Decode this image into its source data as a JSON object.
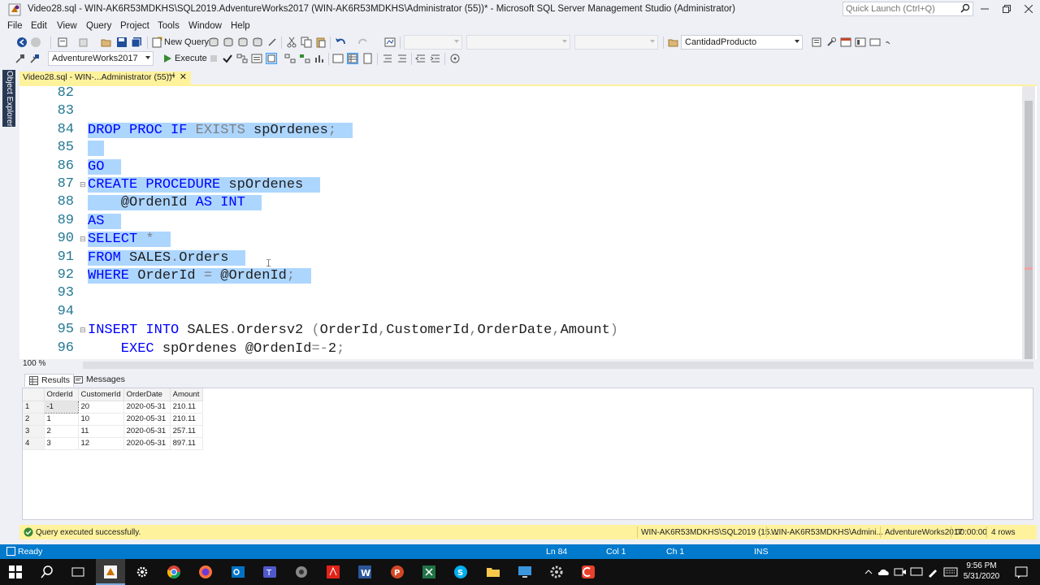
{
  "window": {
    "title": "Video28.sql - WIN-AK6R53MDKHS\\SQL2019.AdventureWorks2017 (WIN-AK6R53MDKHS\\Administrator (55))* - Microsoft SQL Server Management Studio (Administrator)",
    "quick_launch_placeholder": "Quick Launch (Ctrl+Q)"
  },
  "menu": [
    "File",
    "Edit",
    "View",
    "Query",
    "Project",
    "Tools",
    "Window",
    "Help"
  ],
  "toolbar": {
    "new_query_label": "New Query",
    "database": "AdventureWorks2017",
    "execute_label": "Execute",
    "object_combo": "CantidadProducto"
  },
  "side_panel": {
    "label": "Object Explorer"
  },
  "document_tab": {
    "label": "Video28.sql - WIN-...Administrator (55))*",
    "pin": "⊣",
    "close": "✕"
  },
  "editor": {
    "line_numbers": [
      "82",
      "83",
      "84",
      "85",
      "86",
      "87",
      "88",
      "89",
      "90",
      "91",
      "92",
      "93",
      "94",
      "95",
      "96"
    ],
    "lines": [
      [],
      [],
      [
        {
          "t": "DROP PROC IF ",
          "c": "kw"
        },
        {
          "t": "EXISTS",
          "c": "gr"
        },
        {
          "t": " spOrdenes",
          "c": "pl"
        },
        {
          "t": ";",
          "c": "gr"
        }
      ],
      [],
      [
        {
          "t": "GO",
          "c": "kw"
        }
      ],
      [
        {
          "t": "CREATE PROCEDURE",
          "c": "kw"
        },
        {
          "t": " spOrdenes",
          "c": "pl"
        }
      ],
      [
        {
          "t": "    @OrdenId",
          "c": "pl"
        },
        {
          "t": " AS ",
          "c": "kw"
        },
        {
          "t": "INT",
          "c": "kw"
        }
      ],
      [
        {
          "t": "AS",
          "c": "kw"
        }
      ],
      [
        {
          "t": "SELECT",
          "c": "kw"
        },
        {
          "t": " *",
          "c": "gr"
        }
      ],
      [
        {
          "t": "FROM",
          "c": "kw"
        },
        {
          "t": " SALES",
          "c": "pl"
        },
        {
          "t": ".",
          "c": "gr"
        },
        {
          "t": "Orders",
          "c": "pl"
        }
      ],
      [
        {
          "t": "WHERE",
          "c": "kw"
        },
        {
          "t": " OrderId ",
          "c": "pl"
        },
        {
          "t": "=",
          "c": "gr"
        },
        {
          "t": " @OrdenId",
          "c": "pl"
        },
        {
          "t": ";",
          "c": "gr"
        }
      ],
      [],
      [],
      [
        {
          "t": "INSERT INTO",
          "c": "kw"
        },
        {
          "t": " SALES",
          "c": "pl"
        },
        {
          "t": ".",
          "c": "gr"
        },
        {
          "t": "Ordersv2 ",
          "c": "pl"
        },
        {
          "t": "(",
          "c": "gr"
        },
        {
          "t": "OrderId",
          "c": "pl"
        },
        {
          "t": ",",
          "c": "gr"
        },
        {
          "t": "CustomerId",
          "c": "pl"
        },
        {
          "t": ",",
          "c": "gr"
        },
        {
          "t": "OrderDate",
          "c": "pl"
        },
        {
          "t": ",",
          "c": "gr"
        },
        {
          "t": "Amount",
          "c": "pl"
        },
        {
          "t": ")",
          "c": "gr"
        }
      ],
      [
        {
          "t": "    EXEC",
          "c": "kw"
        },
        {
          "t": " spOrdenes @OrdenId",
          "c": "pl"
        },
        {
          "t": "=-",
          "c": "gr"
        },
        {
          "t": "2",
          "c": "pl"
        },
        {
          "t": ";",
          "c": "gr"
        }
      ]
    ],
    "selected_lines": [
      2,
      3,
      4,
      5,
      6,
      7,
      8,
      9,
      10
    ],
    "collapse_markers": [
      5,
      8,
      13
    ],
    "zoom": "100 %"
  },
  "results": {
    "tabs": [
      "Results",
      "Messages"
    ],
    "columns": [
      "OrderId",
      "CustomerId",
      "OrderDate",
      "Amount"
    ],
    "rows": [
      {
        "n": "1",
        "cells": [
          "-1",
          "20",
          "2020-05-31",
          "210.11"
        ]
      },
      {
        "n": "2",
        "cells": [
          "1",
          "10",
          "2020-05-31",
          "210.11"
        ]
      },
      {
        "n": "3",
        "cells": [
          "2",
          "11",
          "2020-05-31",
          "257.11"
        ]
      },
      {
        "n": "4",
        "cells": [
          "3",
          "12",
          "2020-05-31",
          "897.11"
        ]
      }
    ]
  },
  "query_status": {
    "message": "Query executed successfully.",
    "server": "WIN-AK6R53MDKHS\\SQL2019 (15....",
    "user": "WIN-AK6R53MDKHS\\Admini...",
    "database": "AdventureWorks2017",
    "elapsed": "00:00:00",
    "rows": "4 rows"
  },
  "status_bar": {
    "state": "Ready",
    "ln": "Ln 84",
    "col": "Col 1",
    "ch": "Ch 1",
    "mode": "INS"
  },
  "taskbar": {
    "time": "9:56 PM",
    "date": "5/31/2020"
  },
  "colors": {
    "accent": "#007acc",
    "tab_yellow": "#fff29d",
    "selection": "#add6ff",
    "keyword": "#0000ff",
    "line_number": "#237893"
  }
}
